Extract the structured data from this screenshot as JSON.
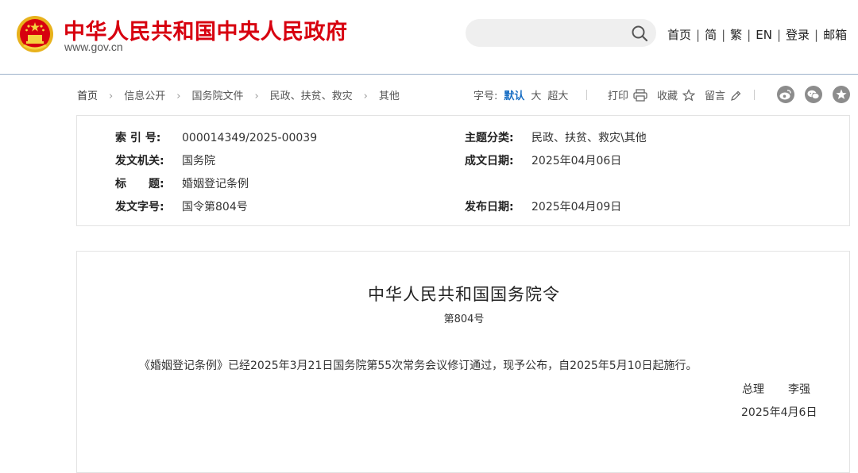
{
  "header": {
    "site_title": "中华人民共和国中央人民政府",
    "site_url": "www.gov.cn",
    "search": {
      "placeholder": "",
      "value": ""
    },
    "nav": [
      {
        "label": "首页"
      },
      {
        "label": "简"
      },
      {
        "label": "繁"
      },
      {
        "label": "EN"
      },
      {
        "label": "登录"
      },
      {
        "label": "邮箱"
      }
    ]
  },
  "breadcrumb": [
    "首页",
    "信息公开",
    "国务院文件",
    "民政、扶贫、救灾",
    "其他"
  ],
  "font_size": {
    "label": "字号:",
    "options": [
      {
        "label": "默认",
        "active": true
      },
      {
        "label": "大",
        "active": false
      },
      {
        "label": "超大",
        "active": false
      }
    ]
  },
  "tools": {
    "print": "打印",
    "favorite": "收藏",
    "comment": "留言"
  },
  "share_icons": [
    "weibo-icon",
    "wechat-icon",
    "star-circle-icon"
  ],
  "info": {
    "index_no_label": "索 引 号:",
    "index_no": "000014349/2025-00039",
    "category_label": "主题分类:",
    "category": "民政、扶贫、救灾\\其他",
    "issuer_label": "发文机关:",
    "issuer": "国务院",
    "created_label": "成文日期:",
    "created": "2025年04月06日",
    "title_label": "标　　题:",
    "title": "婚姻登记条例",
    "doc_no_label": "发文字号:",
    "doc_no": "国令第804号",
    "published_label": "发布日期:",
    "published": "2025年04月09日"
  },
  "document": {
    "title": "中华人民共和国国务院令",
    "number": "第804号",
    "paragraph": "《婚姻登记条例》已经2025年3月21日国务院第55次常务会议修订通过，现予公布，自2025年5月10日起施行。",
    "signer_role": "总理",
    "signer_name": "李强",
    "date": "2025年4月6日"
  },
  "colors": {
    "brand_red": "#d7000f",
    "accent_blue": "#1a6fc4",
    "header_rule": "#9cb1c9"
  }
}
